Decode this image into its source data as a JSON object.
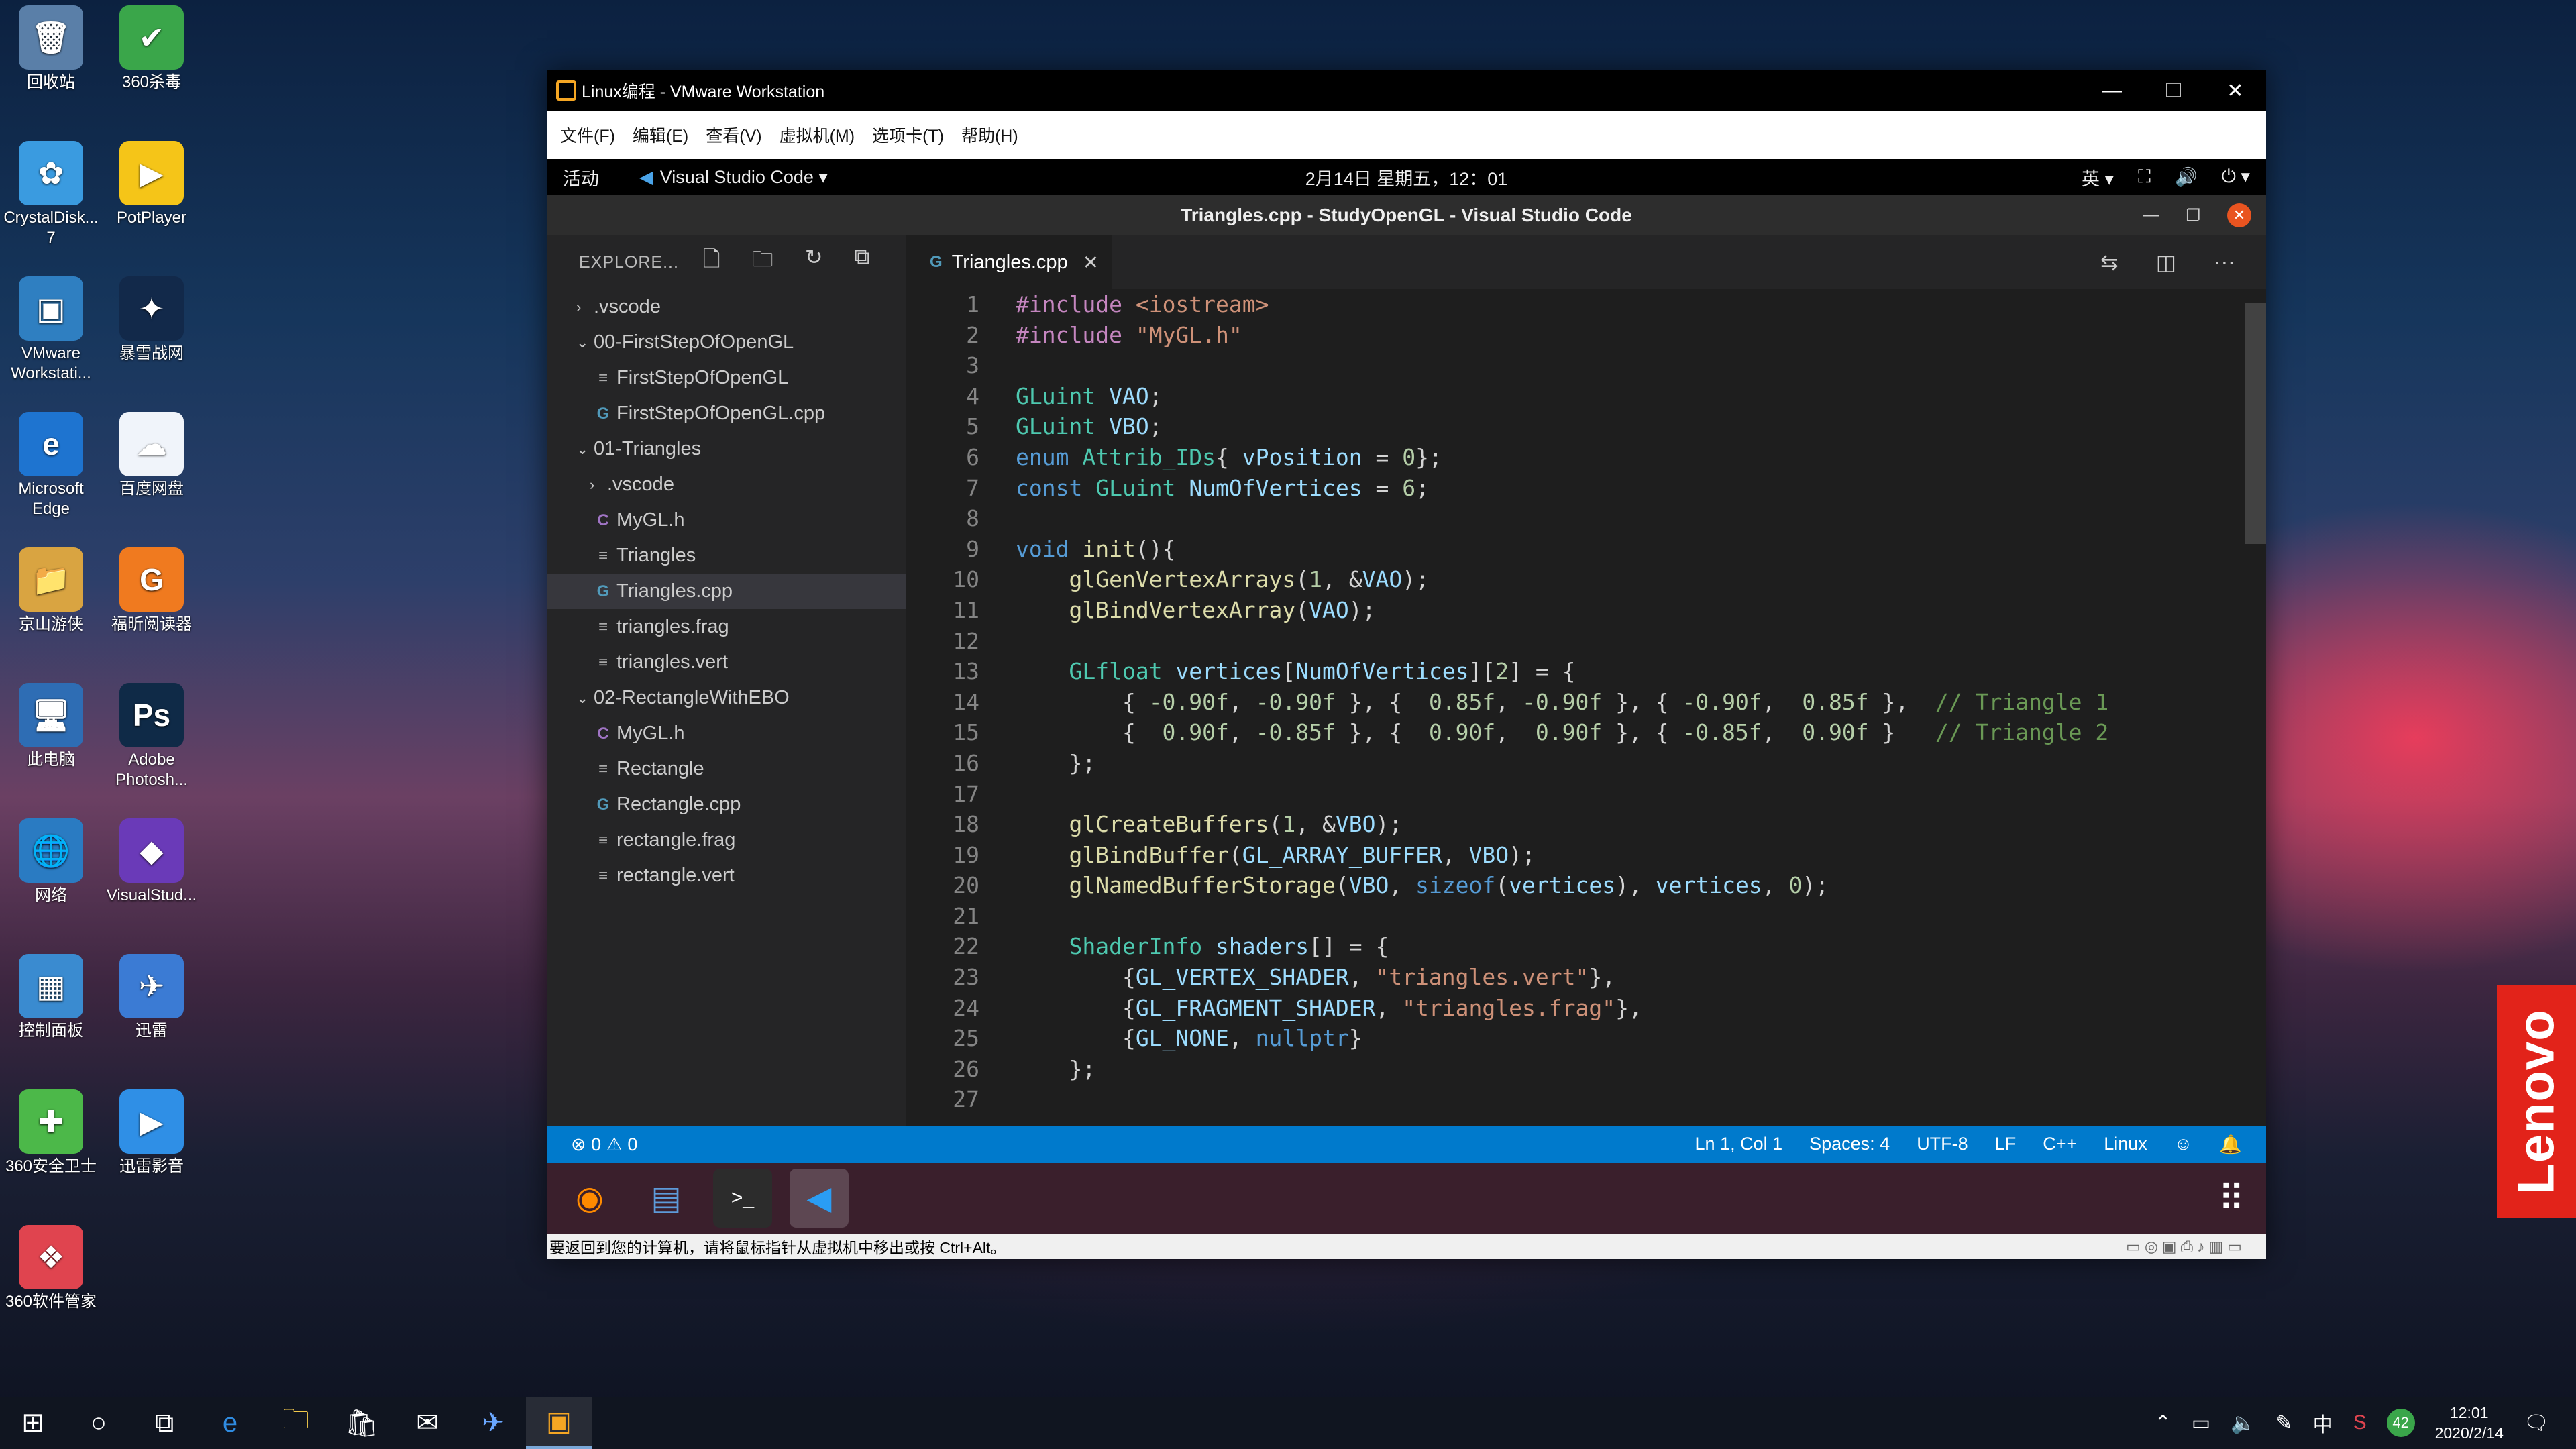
{
  "desktop": {
    "icons": [
      {
        "label": "回收站",
        "glyph": "🗑",
        "color": "#5a7fa8"
      },
      {
        "label": "360杀毒",
        "glyph": "✔",
        "color": "#3aa64a"
      },
      {
        "label": "CrystalDisk...\n7",
        "glyph": "✿",
        "color": "#3a9be0"
      },
      {
        "label": "PotPlayer",
        "glyph": "▶",
        "color": "#f5c518"
      },
      {
        "label": "VMware\nWorkstati...",
        "glyph": "▣",
        "color": "#2f7fc1"
      },
      {
        "label": "暴雪战网",
        "glyph": "✦",
        "color": "#12294a"
      },
      {
        "label": "Microsoft\nEdge",
        "glyph": "e",
        "color": "#1e74d0"
      },
      {
        "label": "百度网盘",
        "glyph": "☁",
        "color": "#f0f4fa"
      },
      {
        "label": "京山游侠",
        "glyph": "📁",
        "color": "#d9a441"
      },
      {
        "label": "福昕阅读器",
        "glyph": "G",
        "color": "#f07a1f"
      },
      {
        "label": "此电脑",
        "glyph": "🖥",
        "color": "#2e6db4"
      },
      {
        "label": "Adobe\nPhotosh...",
        "glyph": "Ps",
        "color": "#0f2a47"
      },
      {
        "label": "网络",
        "glyph": "🌐",
        "color": "#2a7bc2"
      },
      {
        "label": "VisualStud...",
        "glyph": "◆",
        "color": "#6a3ab8"
      },
      {
        "label": "控制面板",
        "glyph": "▦",
        "color": "#3a8bd0"
      },
      {
        "label": "迅雷",
        "glyph": "✈",
        "color": "#3b7bd4"
      },
      {
        "label": "360安全卫士",
        "glyph": "✚",
        "color": "#4cb849"
      },
      {
        "label": "迅雷影音",
        "glyph": "▶",
        "color": "#2f8fe6"
      },
      {
        "label": "360软件管家",
        "glyph": "❖",
        "color": "#e0444f"
      }
    ],
    "lenovo_label": "Lenovo"
  },
  "vmware": {
    "title": "Linux编程 - VMware Workstation",
    "menu": [
      "文件(F)",
      "编辑(E)",
      "查看(V)",
      "虚拟机(M)",
      "选项卡(T)",
      "帮助(H)"
    ],
    "status_hint": "要返回到您的计算机，请将鼠标指针从虚拟机中移出或按 Ctrl+Alt。"
  },
  "ubuntu": {
    "activities": "活动",
    "app_menu": "Visual Studio Code ▾",
    "clock": "2月14日 星期五，12：01",
    "input_method": "英 ▾"
  },
  "vscode": {
    "title": "Triangles.cpp - StudyOpenGL - Visual Studio Code",
    "explorer_label": "EXPLORE...",
    "tree": [
      {
        "label": ".vscode",
        "chev": "›",
        "icon": "",
        "indent": 0
      },
      {
        "label": "00-FirstStepOfOpenGL",
        "chev": "⌄",
        "icon": "",
        "indent": 0
      },
      {
        "label": "FirstStepOfOpenGL",
        "chev": "",
        "icon": "≡",
        "indent": 1
      },
      {
        "label": "FirstStepOfOpenGL.cpp",
        "chev": "",
        "icon": "G",
        "indent": 1
      },
      {
        "label": "01-Triangles",
        "chev": "⌄",
        "icon": "",
        "indent": 0
      },
      {
        "label": ".vscode",
        "chev": "›",
        "icon": "",
        "indent": 1
      },
      {
        "label": "MyGL.h",
        "chev": "",
        "icon": "C",
        "indent": 1
      },
      {
        "label": "Triangles",
        "chev": "",
        "icon": "≡",
        "indent": 1
      },
      {
        "label": "Triangles.cpp",
        "chev": "",
        "icon": "G",
        "indent": 1,
        "active": true
      },
      {
        "label": "triangles.frag",
        "chev": "",
        "icon": "≡",
        "indent": 1
      },
      {
        "label": "triangles.vert",
        "chev": "",
        "icon": "≡",
        "indent": 1
      },
      {
        "label": "02-RectangleWithEBO",
        "chev": "⌄",
        "icon": "",
        "indent": 0
      },
      {
        "label": "MyGL.h",
        "chev": "",
        "icon": "C",
        "indent": 1
      },
      {
        "label": "Rectangle",
        "chev": "",
        "icon": "≡",
        "indent": 1
      },
      {
        "label": "Rectangle.cpp",
        "chev": "",
        "icon": "G",
        "indent": 1
      },
      {
        "label": "rectangle.frag",
        "chev": "",
        "icon": "≡",
        "indent": 1
      },
      {
        "label": "rectangle.vert",
        "chev": "",
        "icon": "≡",
        "indent": 1
      }
    ],
    "tab": "Triangles.cpp",
    "code": [
      "<span class=\"p\">#include</span> <span class=\"s\">&lt;iostream&gt;</span>",
      "<span class=\"p\">#include</span> <span class=\"s\">\"MyGL.h\"</span>",
      "",
      "<span class=\"t\">GLuint</span> <span class=\"v\">VAO</span>;",
      "<span class=\"t\">GLuint</span> <span class=\"v\">VBO</span>;",
      "<span class=\"k\">enum</span> <span class=\"t\">Attrib_IDs</span>{ <span class=\"v\">vPosition</span> = <span class=\"n\">0</span>};",
      "<span class=\"k\">const</span> <span class=\"t\">GLuint</span> <span class=\"v\">NumOfVertices</span> = <span class=\"n\">6</span>;",
      "",
      "<span class=\"k\">void</span> <span class=\"f\">init</span>(){",
      "    <span class=\"f\">glGenVertexArrays</span>(<span class=\"n\">1</span>, &amp;<span class=\"v\">VAO</span>);",
      "    <span class=\"f\">glBindVertexArray</span>(<span class=\"v\">VAO</span>);",
      "",
      "    <span class=\"t\">GLfloat</span> <span class=\"v\">vertices</span>[<span class=\"v\">NumOfVertices</span>][<span class=\"n\">2</span>] = {",
      "        { <span class=\"n\">-0.90f</span>, <span class=\"n\">-0.90f</span> }, {  <span class=\"n\">0.85f</span>, <span class=\"n\">-0.90f</span> }, { <span class=\"n\">-0.90f</span>,  <span class=\"n\">0.85f</span> },  <span class=\"c\">// Triangle 1</span>",
      "        {  <span class=\"n\">0.90f</span>, <span class=\"n\">-0.85f</span> }, {  <span class=\"n\">0.90f</span>,  <span class=\"n\">0.90f</span> }, { <span class=\"n\">-0.85f</span>,  <span class=\"n\">0.90f</span> }   <span class=\"c\">// Triangle 2</span>",
      "    };",
      "",
      "    <span class=\"f\">glCreateBuffers</span>(<span class=\"n\">1</span>, &amp;<span class=\"v\">VBO</span>);",
      "    <span class=\"f\">glBindBuffer</span>(<span class=\"v\">GL_ARRAY_BUFFER</span>, <span class=\"v\">VBO</span>);",
      "    <span class=\"f\">glNamedBufferStorage</span>(<span class=\"v\">VBO</span>, <span class=\"k\">sizeof</span>(<span class=\"v\">vertices</span>), <span class=\"v\">vertices</span>, <span class=\"n\">0</span>);",
      "",
      "    <span class=\"t\">ShaderInfo</span> <span class=\"v\">shaders</span>[] = {",
      "        {<span class=\"v\">GL_VERTEX_SHADER</span>, <span class=\"s\">\"triangles.vert\"</span>},",
      "        {<span class=\"v\">GL_FRAGMENT_SHADER</span>, <span class=\"s\">\"triangles.frag\"</span>},",
      "        {<span class=\"v\">GL_NONE</span>, <span class=\"k\">nullptr</span>}",
      "    };",
      ""
    ],
    "status": {
      "problems": "⊗ 0 ⚠ 0",
      "position": "Ln 1, Col 1",
      "spaces": "Spaces: 4",
      "encoding": "UTF-8",
      "eol": "LF",
      "language": "C++",
      "platform": "Linux"
    }
  },
  "taskbar": {
    "time": "12:01",
    "date": "2020/2/14",
    "ime": "中",
    "badge": "42"
  }
}
